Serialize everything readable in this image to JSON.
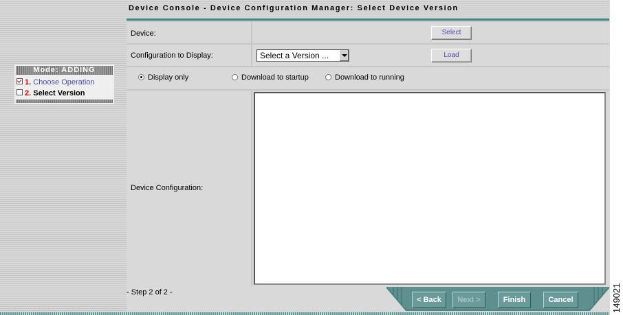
{
  "header": {
    "title": "Device Console - Device Configuration Manager: Select Device Version"
  },
  "sidebar": {
    "mode_label": "Mode: ADDING",
    "steps": [
      {
        "number": "1.",
        "label": "Choose Operation",
        "checked": true
      },
      {
        "number": "2.",
        "label": "Select Version",
        "checked": false
      }
    ]
  },
  "form": {
    "device_label": "Device:",
    "select_button": "Select",
    "config_display_label": "Configuration to Display:",
    "version_select_value": "Select a Version ...",
    "load_button": "Load",
    "radio_options": [
      {
        "label": "Display only",
        "selected": true
      },
      {
        "label": "Download to startup",
        "selected": false
      },
      {
        "label": "Download to running",
        "selected": false
      }
    ],
    "device_config_label": "Device Configuration:",
    "device_config_value": ""
  },
  "footer": {
    "step_indicator": "- Step 2 of 2 -",
    "buttons": {
      "back": "< Back",
      "next": "Next >",
      "finish": "Finish",
      "cancel": "Cancel"
    }
  },
  "figure_id": "149021",
  "colors": {
    "accent_teal": "#3c8a8a",
    "nav_button": "#6a9a9a",
    "link_blue": "#4a4aa8",
    "step_red": "#cc0000"
  }
}
